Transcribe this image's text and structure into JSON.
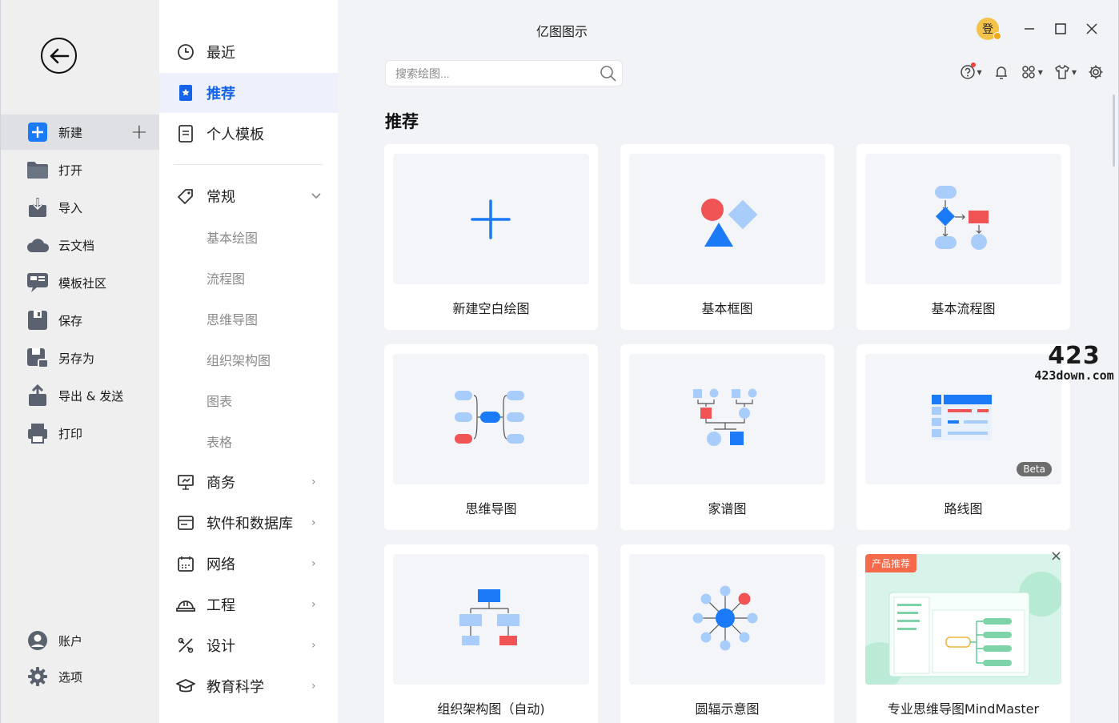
{
  "window": {
    "title": "亿图图示",
    "avatar_text": "登"
  },
  "rail": {
    "items": [
      {
        "label": "新建",
        "icon": "new-icon"
      },
      {
        "label": "打开",
        "icon": "folder-icon"
      },
      {
        "label": "导入",
        "icon": "import-icon"
      },
      {
        "label": "云文档",
        "icon": "cloud-icon"
      },
      {
        "label": "模板社区",
        "icon": "community-icon"
      },
      {
        "label": "保存",
        "icon": "save-icon"
      },
      {
        "label": "另存为",
        "icon": "save-as-icon"
      },
      {
        "label": "导出 & 发送",
        "icon": "export-icon"
      },
      {
        "label": "打印",
        "icon": "print-icon"
      }
    ],
    "bottom": [
      {
        "label": "账户",
        "icon": "account-icon"
      },
      {
        "label": "选项",
        "icon": "gear-icon"
      }
    ],
    "plus": "+"
  },
  "categories": {
    "top": [
      {
        "label": "最近",
        "icon": "clock-icon"
      },
      {
        "label": "推荐",
        "icon": "bookmark-icon"
      },
      {
        "label": "个人模板",
        "icon": "document-icon"
      }
    ],
    "general": {
      "label": "常规",
      "icon": "tag-icon",
      "chevron": "⌄"
    },
    "general_sub": [
      "基本绘图",
      "流程图",
      "思维导图",
      "组织架构图",
      "图表",
      "表格"
    ],
    "groups": [
      {
        "label": "商务",
        "icon": "presentation-icon"
      },
      {
        "label": "软件和数据库",
        "icon": "browser-icon"
      },
      {
        "label": "网络",
        "icon": "network-icon"
      },
      {
        "label": "工程",
        "icon": "helmet-icon"
      },
      {
        "label": "设计",
        "icon": "design-icon"
      },
      {
        "label": "教育科学",
        "icon": "education-icon"
      }
    ],
    "chevron": "›"
  },
  "search": {
    "placeholder": "搜索绘图..."
  },
  "main": {
    "section_title": "推荐",
    "cards": [
      {
        "label": "新建空白绘图"
      },
      {
        "label": "基本框图"
      },
      {
        "label": "基本流程图"
      },
      {
        "label": "思维导图"
      },
      {
        "label": "家谱图"
      },
      {
        "label": "路线图",
        "badge": "Beta"
      },
      {
        "label": "组织架构图（自动)"
      },
      {
        "label": "圆辐示意图"
      },
      {
        "label": "专业思维导图MindMaster",
        "tag": "产品推荐",
        "close": "×"
      }
    ]
  },
  "watermark": {
    "big": "423",
    "small": "423down.com"
  },
  "colors": {
    "accent": "#1463e8",
    "blue": "#1a7af8",
    "light_blue": "#a9cdfb",
    "red": "#f05454",
    "rail_bg": "#efefef",
    "main_bg": "#f2f3f7"
  }
}
